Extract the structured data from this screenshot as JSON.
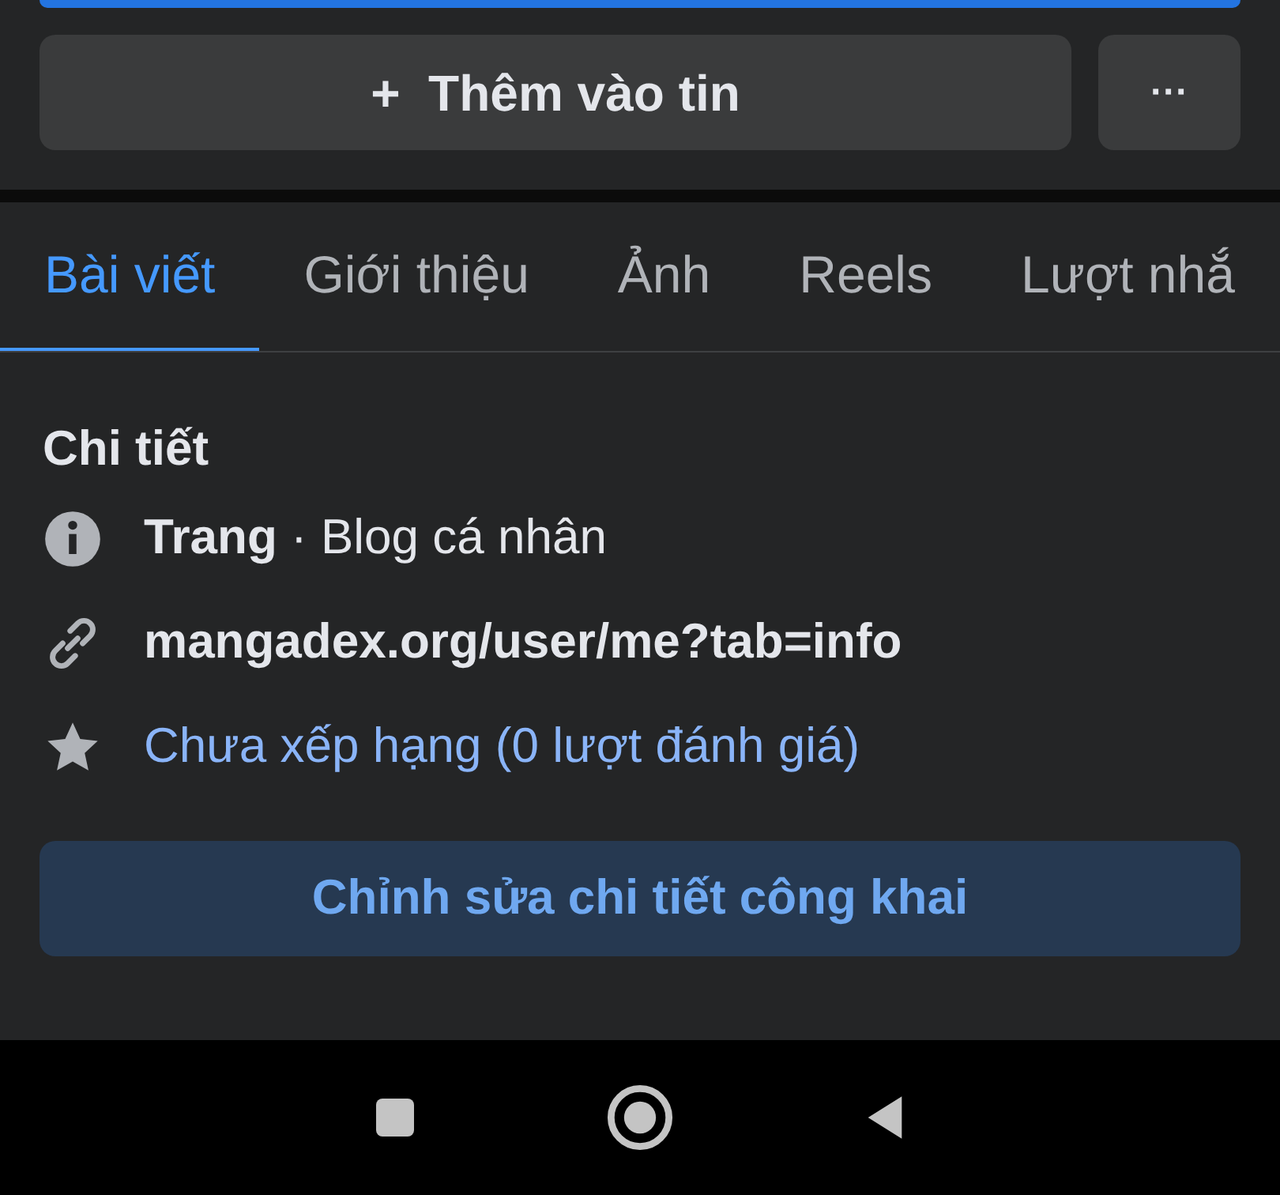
{
  "top_button": {
    "kind": "primary"
  },
  "story_button": {
    "icon": "+",
    "label": "Thêm vào tin"
  },
  "more_button": {
    "label": "···"
  },
  "tabs": [
    {
      "label": "Bài viết",
      "selected": true
    },
    {
      "label": "Giới thiệu",
      "selected": false
    },
    {
      "label": "Ảnh",
      "selected": false
    },
    {
      "label": "Reels",
      "selected": false
    },
    {
      "label": "Lượt nhắ",
      "selected": false
    }
  ],
  "details": {
    "title": "Chi tiết",
    "rows": [
      {
        "kind": "info",
        "text": "**Trang** · Blog cá nhân"
      },
      {
        "kind": "link",
        "text": "mangadex.org/user/me?tab=info"
      },
      {
        "kind": "rating",
        "text": "Chưa xếp hạng (0 lượt đánh giá)"
      }
    ]
  },
  "edit_button": {
    "label": "Chỉnh sửa chi tiết công khai"
  },
  "nav_bar": [
    {
      "kind": "recents"
    },
    {
      "kind": "home"
    },
    {
      "kind": "back"
    }
  ]
}
